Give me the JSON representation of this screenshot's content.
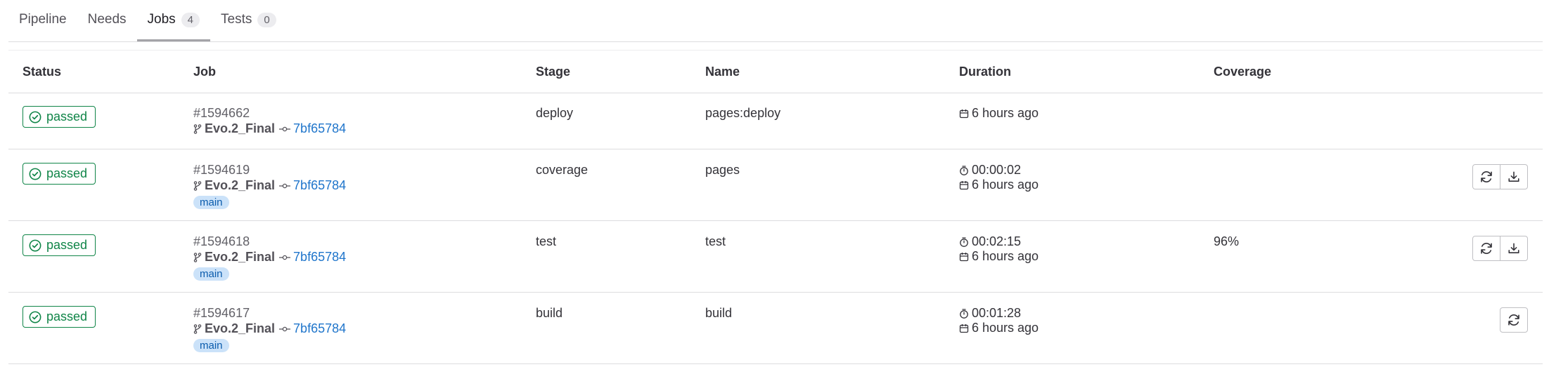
{
  "tabs": [
    {
      "label": "Pipeline",
      "count": null
    },
    {
      "label": "Needs",
      "count": null
    },
    {
      "label": "Jobs",
      "count": "4"
    },
    {
      "label": "Tests",
      "count": "0"
    }
  ],
  "table": {
    "headers": {
      "status": "Status",
      "job": "Job",
      "stage": "Stage",
      "name": "Name",
      "duration": "Duration",
      "coverage": "Coverage"
    },
    "rows": [
      {
        "status": "passed",
        "job_id": "#1594662",
        "ref": "Evo.2_Final",
        "sha": "7bf65784",
        "branch": "",
        "stage": "deploy",
        "name": "pages:deploy",
        "duration": "",
        "finished": "6 hours ago",
        "coverage": "",
        "actions": []
      },
      {
        "status": "passed",
        "job_id": "#1594619",
        "ref": "Evo.2_Final",
        "sha": "7bf65784",
        "branch": "main",
        "stage": "coverage",
        "name": "pages",
        "duration": "00:00:02",
        "finished": "6 hours ago",
        "coverage": "",
        "actions": [
          "retry",
          "download"
        ]
      },
      {
        "status": "passed",
        "job_id": "#1594618",
        "ref": "Evo.2_Final",
        "sha": "7bf65784",
        "branch": "main",
        "stage": "test",
        "name": "test",
        "duration": "00:02:15",
        "finished": "6 hours ago",
        "coverage": "96%",
        "actions": [
          "retry",
          "download"
        ]
      },
      {
        "status": "passed",
        "job_id": "#1594617",
        "ref": "Evo.2_Final",
        "sha": "7bf65784",
        "branch": "main",
        "stage": "build",
        "name": "build",
        "duration": "00:01:28",
        "finished": "6 hours ago",
        "coverage": "",
        "actions": [
          "retry"
        ]
      }
    ]
  },
  "icons": {
    "status": "check-circle-icon",
    "ref": "branch-icon",
    "commit": "commit-icon",
    "duration": "timer-icon",
    "finished": "calendar-icon",
    "retry": "retry-icon",
    "download": "download-icon"
  },
  "colors": {
    "passed": "#108548",
    "link": "#1f75cb",
    "branch_pill_bg": "#cbe2f9"
  }
}
